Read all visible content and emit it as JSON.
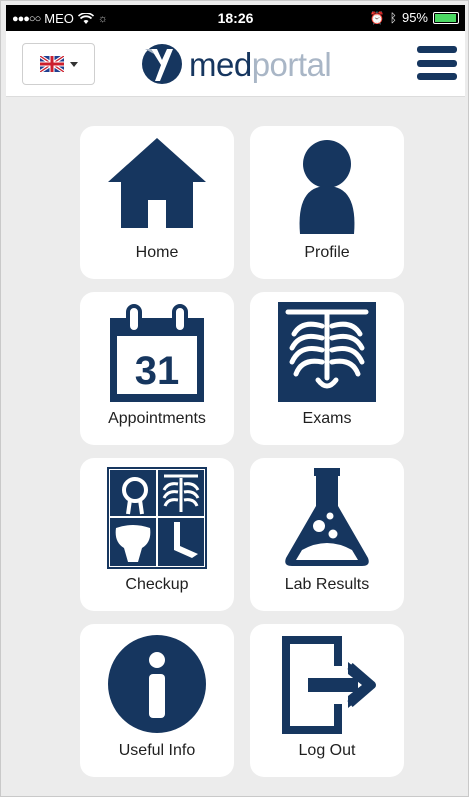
{
  "status_bar": {
    "carrier": "MEO",
    "time": "18:26",
    "battery": "95%"
  },
  "header": {
    "language_flag": "uk-flag-icon",
    "logo_main": "med",
    "logo_light": "portal"
  },
  "tiles": [
    {
      "label": "Home",
      "icon": "home-icon"
    },
    {
      "label": "Profile",
      "icon": "profile-icon"
    },
    {
      "label": "Appointments",
      "icon": "calendar-icon",
      "calendar_day": "31"
    },
    {
      "label": "Exams",
      "icon": "xray-icon"
    },
    {
      "label": "Checkup",
      "icon": "checkup-icon"
    },
    {
      "label": "Lab Results",
      "icon": "flask-icon"
    },
    {
      "label": "Useful Info",
      "icon": "info-icon"
    },
    {
      "label": "Log Out",
      "icon": "logout-icon"
    }
  ],
  "colors": {
    "brand_navy": "#16365f",
    "brand_light": "#a9b6c6",
    "background": "#ececec",
    "tile": "#ffffff"
  }
}
